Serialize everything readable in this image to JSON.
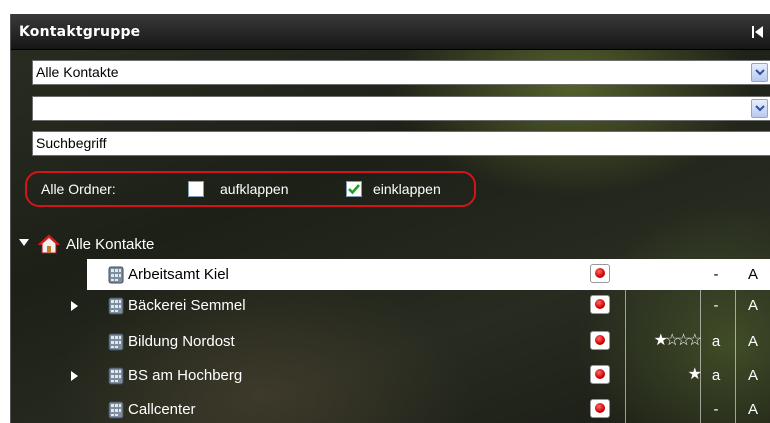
{
  "header": {
    "title": "Kontaktgruppe"
  },
  "filters": {
    "group_select": "Alle Kontakte",
    "second_select": "",
    "search_value": "Suchbegriff"
  },
  "folders": {
    "label": "Alle Ordner:",
    "expand_label": "aufklappen",
    "expand_checked": false,
    "collapse_label": "einklappen",
    "collapse_checked": true
  },
  "tree": {
    "root_label": "Alle Kontakte",
    "rows": [
      {
        "name": "Arbeitsamt Kiel",
        "stars": "",
        "col_a": "-",
        "col_b": "A",
        "selected": true,
        "expandable": false
      },
      {
        "name": "Bäckerei Semmel",
        "stars": "",
        "col_a": "-",
        "col_b": "A",
        "selected": false,
        "expandable": true
      },
      {
        "name": "Bildung Nordost",
        "stars": "★☆☆☆",
        "col_a": "a",
        "col_b": "A",
        "selected": false,
        "expandable": false
      },
      {
        "name": "BS am Hochberg",
        "stars": "★",
        "col_a": "a",
        "col_b": "A",
        "selected": false,
        "expandable": true
      },
      {
        "name": "Callcenter",
        "stars": "",
        "col_a": "-",
        "col_b": "A",
        "selected": false,
        "expandable": false
      }
    ]
  },
  "colors": {
    "highlight_border": "#d4141b",
    "header_bg": "#1e1e1e"
  }
}
